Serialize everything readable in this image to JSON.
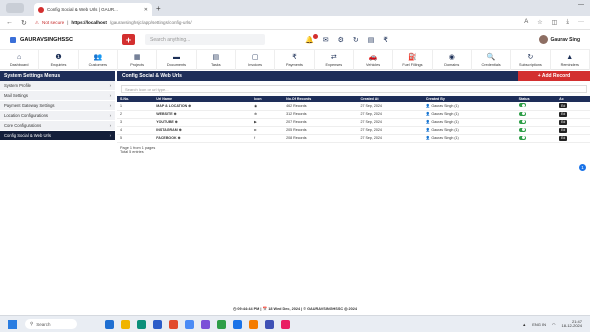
{
  "browser": {
    "tab_title": "Config Social & Web Urls | GAUR...",
    "not_secure": "Not secure",
    "url_host": "https://localhost",
    "url_path": "/gauravsinghsjc/app/settings/config-urls/"
  },
  "app": {
    "brand": "GAURAVSINGHSSC",
    "search_placeholder": "Search anything...",
    "user_name": "Gaurav Sing"
  },
  "modules": [
    {
      "label": "Dashboard",
      "icon": "⌂"
    },
    {
      "label": "Enquiries",
      "icon": "❶"
    },
    {
      "label": "Customers",
      "icon": "👥"
    },
    {
      "label": "Projects",
      "icon": "▦"
    },
    {
      "label": "Documents",
      "icon": "▬"
    },
    {
      "label": "Tasks",
      "icon": "▤"
    },
    {
      "label": "Invoices",
      "icon": "▢"
    },
    {
      "label": "Payments",
      "icon": "₹"
    },
    {
      "label": "Expenses",
      "icon": "⇄"
    },
    {
      "label": "Vehicles",
      "icon": "🚗"
    },
    {
      "label": "Fuel Fillings",
      "icon": "⛽"
    },
    {
      "label": "Domains",
      "icon": "◉"
    },
    {
      "label": "Credentials",
      "icon": "🔍"
    },
    {
      "label": "Subscriptions",
      "icon": "↻"
    },
    {
      "label": "Reminders",
      "icon": "▲"
    }
  ],
  "sidebar": {
    "title": "System Settings Menus",
    "items": [
      {
        "label": "System Profile",
        "active": false
      },
      {
        "label": "Mail Settings",
        "active": false
      },
      {
        "label": "Payment Gateway Settings",
        "active": false
      },
      {
        "label": "Location Configurations",
        "active": false
      },
      {
        "label": "Core Configurations",
        "active": false
      },
      {
        "label": "Config Social & Web Urls",
        "active": true
      }
    ]
  },
  "main": {
    "title": "Config Social & Web Urls",
    "add_label": "+ Add Record",
    "search_placeholder": "Search Icon or url type...",
    "columns": [
      "S.No.",
      "Url Name",
      "Icon",
      "No.Of Records",
      "Created At",
      "Created By",
      "Status",
      "Ac"
    ],
    "rows": [
      {
        "sno": "1",
        "name": "MAP & LOCATION ⊕",
        "icon": "◉",
        "records": "462 Records",
        "date": "27 Sep, 2024",
        "by": "Gaurav Singh (1)",
        "action": "Ed"
      },
      {
        "sno": "2",
        "name": "WEBSITE ⊕",
        "icon": "⊕",
        "records": "312 Records",
        "date": "27 Sep, 2024",
        "by": "Gaurav Singh (1)",
        "action": "Ed"
      },
      {
        "sno": "3",
        "name": "YOUTUBE ⊕",
        "icon": "▶",
        "records": "207 Records",
        "date": "27 Sep, 2024",
        "by": "Gaurav Singh (1)",
        "action": "Ed"
      },
      {
        "sno": "4",
        "name": "INSTAGRAM ⊕",
        "icon": "◘",
        "records": "205 Records",
        "date": "27 Sep, 2024",
        "by": "Gaurav Singh (1)",
        "action": "Ed"
      },
      {
        "sno": "5",
        "name": "FACEBOOK ⊕",
        "icon": "f",
        "records": "208 Records",
        "date": "27 Sep, 2024",
        "by": "Gaurav Singh (1)",
        "action": "Ed"
      }
    ],
    "page_info": "Page 1 from 1 pages",
    "total_info": "Total 5 entries",
    "current_page": "1"
  },
  "footer": "◷ 09:44:44 PM | 📅 18 Wed Dec, 2024 | © GAURAVSINGHSSC ◎ 2024",
  "taskbar": {
    "search": "Search",
    "lang": "ENG IN",
    "time": "21:47",
    "date": "18-12-2024"
  }
}
